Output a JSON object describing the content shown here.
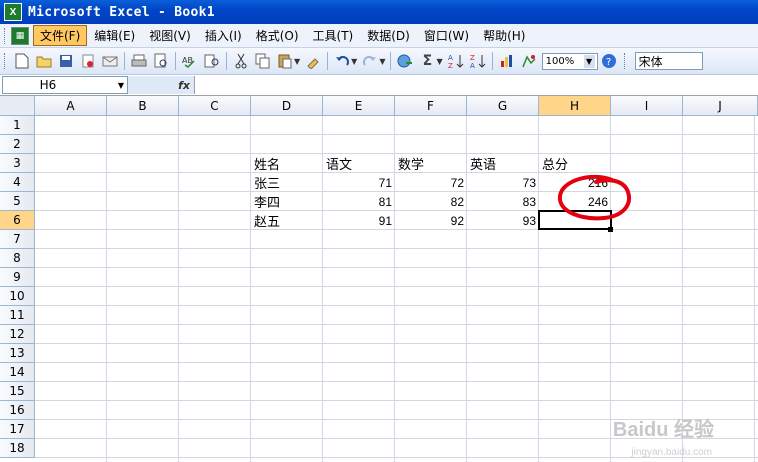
{
  "window": {
    "title": "Microsoft Excel - Book1",
    "app_icon": "excel-icon"
  },
  "menu": {
    "items": [
      "文件(F)",
      "编辑(E)",
      "视图(V)",
      "插入(I)",
      "格式(O)",
      "工具(T)",
      "数据(D)",
      "窗口(W)",
      "帮助(H)"
    ],
    "active_index": 0
  },
  "toolbar": {
    "zoom": "100%",
    "font": "宋体"
  },
  "formula_bar": {
    "name_box": "H6",
    "fx_label": "fx",
    "content": ""
  },
  "sheet": {
    "columns": [
      "A",
      "B",
      "C",
      "D",
      "E",
      "F",
      "G",
      "H",
      "I",
      "J"
    ],
    "rows": [
      "1",
      "2",
      "3",
      "4",
      "5",
      "6",
      "7",
      "8",
      "9",
      "10",
      "11",
      "12",
      "13",
      "14",
      "15",
      "16",
      "17",
      "18"
    ],
    "selected_column": "H",
    "selected_row": "6",
    "headers": {
      "name": "姓名",
      "chinese": "语文",
      "math": "数学",
      "english": "英语",
      "total": "总分"
    },
    "records": [
      {
        "name": "张三",
        "chinese": "71",
        "math": "72",
        "english": "73",
        "total": "216"
      },
      {
        "name": "李四",
        "chinese": "81",
        "math": "82",
        "english": "83",
        "total": "246"
      },
      {
        "name": "赵五",
        "chinese": "91",
        "math": "92",
        "english": "93",
        "total": ""
      }
    ],
    "annotation_color": "#e4000f"
  },
  "watermark": {
    "brand": "Baidu 经验",
    "url": "jingyan.baidu.com"
  }
}
